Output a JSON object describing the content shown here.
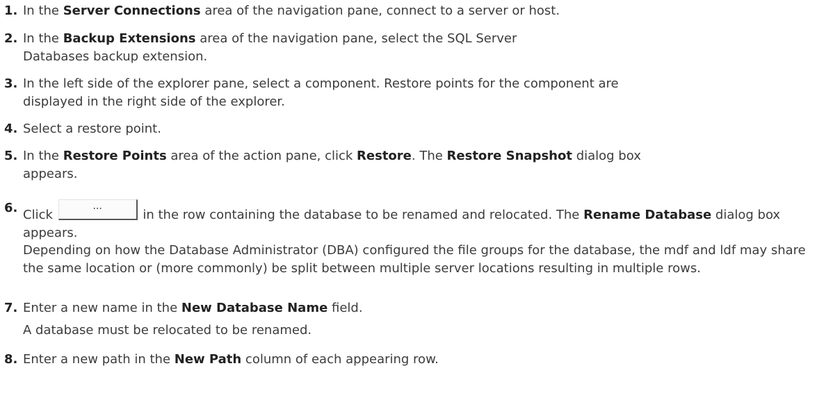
{
  "steps": [
    {
      "num": "1.",
      "t0": "In the ",
      "b0": "Server Connections",
      "t1": " area of the navigation pane, connect to a server or host."
    },
    {
      "num": "2.",
      "t0": "In the ",
      "b0": "Backup Extensions",
      "t1": " area of the navigation pane, select the SQL Server Databases backup extension."
    },
    {
      "num": "3.",
      "t0": "In the left side of the explorer pane, select a component. Restore points for the component are displayed in the right side of the explorer."
    },
    {
      "num": "4.",
      "t0": "Select a restore point."
    },
    {
      "num": "5.",
      "t0": "In the ",
      "b0": "Restore Points",
      "t1": " area of the action pane, click ",
      "b1": "Restore",
      "t2": ". The ",
      "b2": "Restore Snapshot",
      "t3": " dialog box appears."
    },
    {
      "num": "6.",
      "t0": "Click ",
      "button_label": "...",
      "t1": " in the row containing the database to be renamed and relocated. The ",
      "b0": "Rename Database",
      "t2": " dialog box appears.",
      "note": "Depending on how the Database Administrator (DBA) configured the file groups for the database, the mdf and ldf may share the same location or (more commonly) be split between multiple server locations resulting in multiple rows."
    },
    {
      "num": "7.",
      "t0": "Enter a new name in the ",
      "b0": "New Database Name",
      "t1": " field.",
      "note": "A database must be relocated to be renamed."
    },
    {
      "num": "8.",
      "t0": "Enter a new path in the ",
      "b0": "New Path",
      "t1": " column of each appearing row."
    }
  ]
}
